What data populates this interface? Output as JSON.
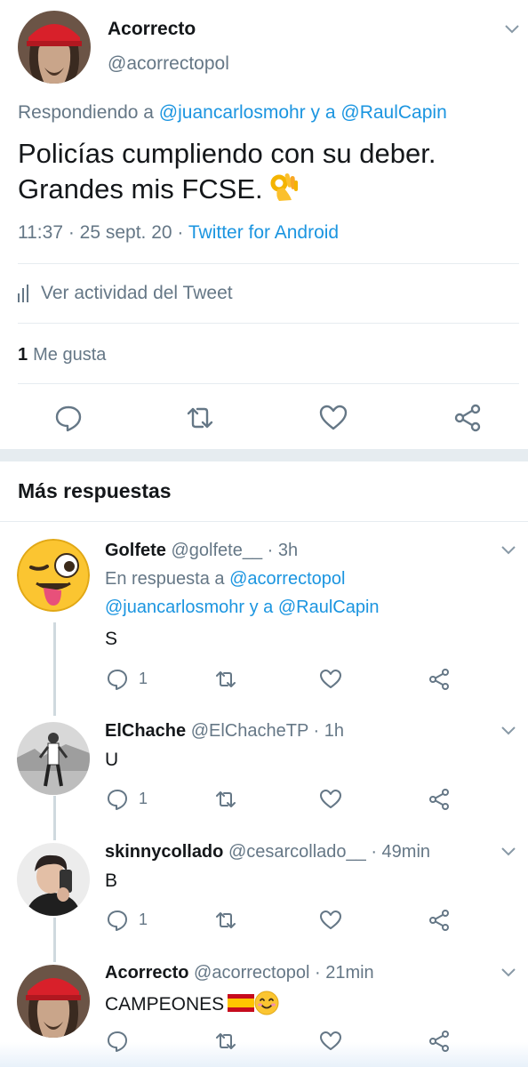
{
  "main_tweet": {
    "display_name": "Acorrecto",
    "handle": "@acorrectopol",
    "replying_prefix": "Respondiendo a ",
    "replying_to_1": "@juancarlosmohr",
    "replying_join": " y a ",
    "replying_to_2": "@RaulCapin",
    "text_line_1": "Policías cumpliendo con su deber.",
    "text_line_2": "Grandes mis FCSE.",
    "emoji_icon": "ok-hand-emoji",
    "time": "11:37 · 25 sept. 20 · ",
    "client": "Twitter for Android",
    "activity_label": "Ver actividad del Tweet",
    "likes_count": "1",
    "likes_label": "Me gusta",
    "actions": [
      "reply-icon",
      "retweet-icon",
      "like-icon",
      "share-icon"
    ]
  },
  "more_replies_title": "Más respuestas",
  "replies": [
    {
      "name": "Golfete",
      "handle": "@golfete__",
      "time": " · 3h",
      "reply_prefix": "En respuesta a ",
      "reply_to_1": "@acorrectopol",
      "reply_to_2": "@juancarlosmohr",
      "reply_join": " y a ",
      "reply_to_3": "@RaulCapin",
      "text": "S",
      "reply_count": "1"
    },
    {
      "name": "ElChache",
      "handle": "@ElChacheTP",
      "time": " · 1h",
      "text": "U",
      "reply_count": "1"
    },
    {
      "name": "skinnycollado",
      "handle": "@cesarcollado__",
      "time": " · 49min",
      "text": "B",
      "reply_count": "1"
    },
    {
      "name": "Acorrecto",
      "handle": "@acorrectopol",
      "time": " · 21min",
      "text": "CAMPEONES",
      "emoji_icons": [
        "spain-flag-emoji",
        "smiling-face-emoji"
      ]
    }
  ],
  "colors": {
    "link": "#1b95e0",
    "secondary_text": "#657786",
    "divider": "#e6ecf0"
  }
}
